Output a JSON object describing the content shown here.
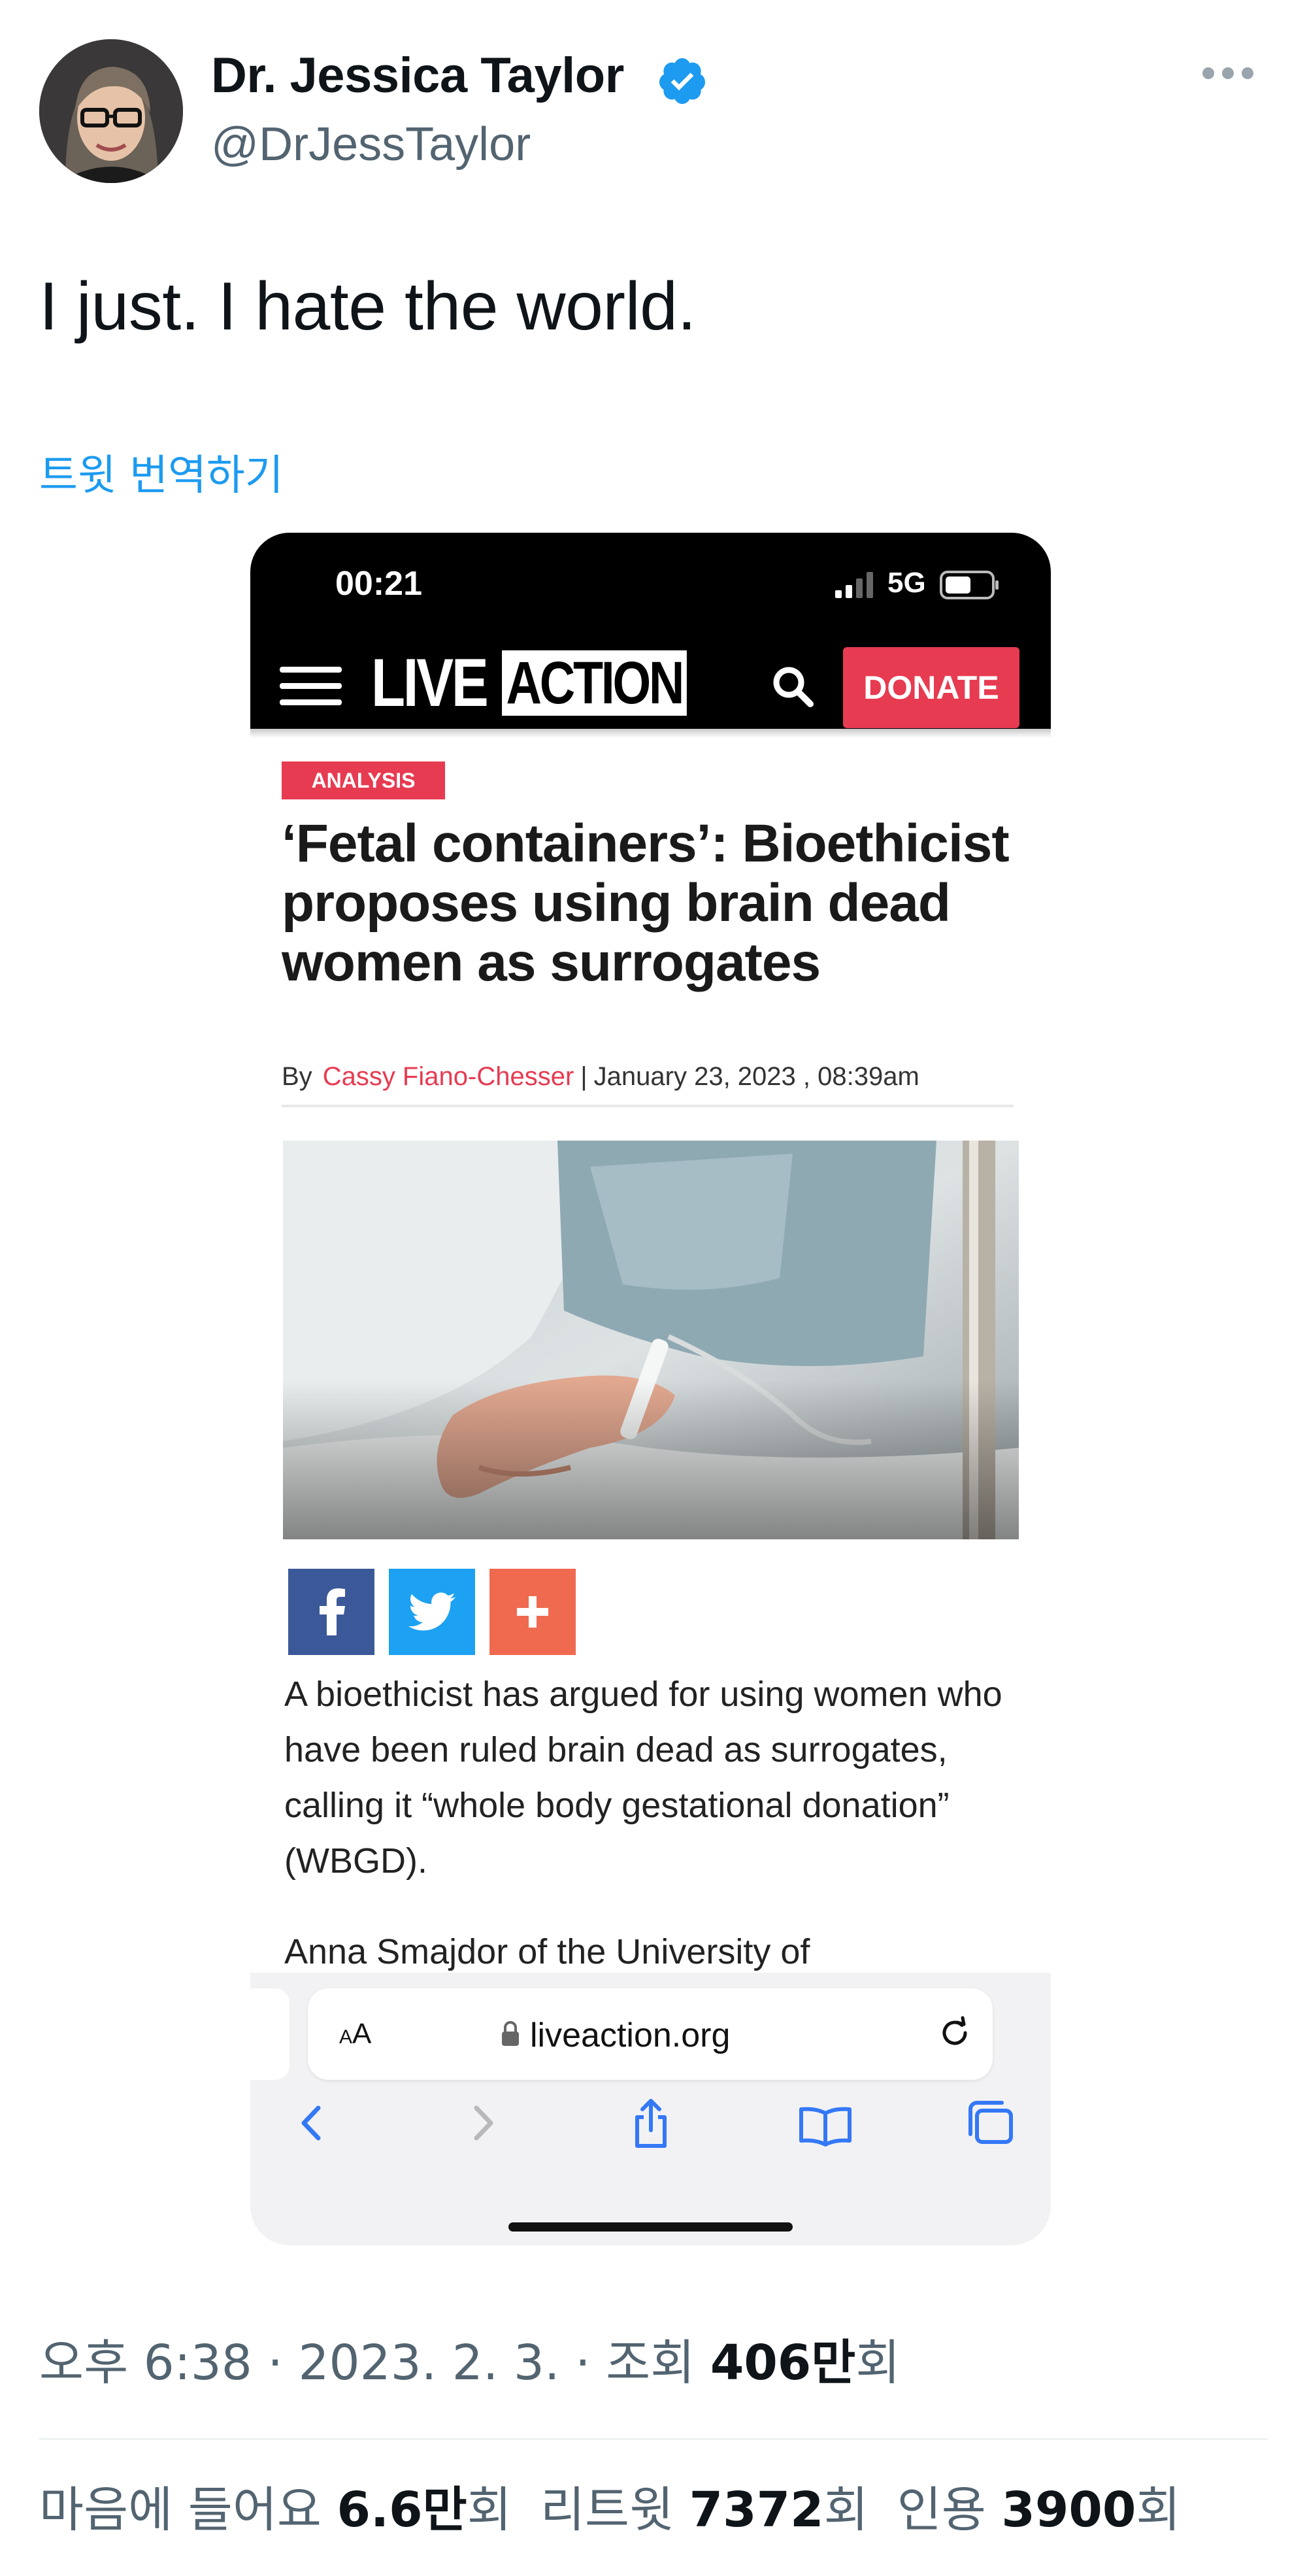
{
  "tweet": {
    "author": {
      "display_name": "Dr. Jessica Taylor",
      "handle": "@DrJessTaylor",
      "verified": true
    },
    "text": "I just. I hate the world.",
    "translate_label": "트윗 번역하기",
    "meta": {
      "time": "오후 6:38",
      "date": "2023. 2. 3.",
      "views_label": "조회",
      "views_value": "406만",
      "views_suffix": "회"
    },
    "stats": {
      "likes_label": "마음에 들어요",
      "likes_value": "6.6만",
      "likes_suffix": "회",
      "retweets_label": "리트윗",
      "retweets_value": "7372",
      "retweets_suffix": "회",
      "quotes_label": "인용",
      "quotes_value": "3900",
      "quotes_suffix": "회"
    }
  },
  "screenshot": {
    "status": {
      "time": "00:21",
      "network": "5G"
    },
    "site": {
      "logo_part1": "LIVE",
      "logo_part2": "ACTION",
      "donate_label": "DONATE"
    },
    "article": {
      "badge": "ANALYSIS",
      "headline": "‘Fetal containers’: Bioethicist proposes using brain dead women as surrogates",
      "by_label": "By",
      "author": "Cassy Fiano-Chesser",
      "separator": "|",
      "date": "January 23, 2023 , 08:39am",
      "paragraph1": "A bioethicist has argued for using women who have been ruled brain dead as surrogates, calling it “whole body gestational donation” (WBGD).",
      "paragraph2_start": "Anna Smajdor of the University of"
    },
    "browser": {
      "aa_small": "A",
      "aa_large": "A",
      "url": "liveaction.org"
    }
  },
  "colors": {
    "link_blue": "#1d9bf0",
    "liveaction_red": "#e73b51",
    "facebook": "#3b5998",
    "twitter": "#1da1f2",
    "share_plus": "#f06a50"
  },
  "icons": [
    "verified-badge-icon",
    "more-icon",
    "signal-icon",
    "battery-icon",
    "hamburger-menu-icon",
    "search-icon",
    "facebook-icon",
    "twitter-icon",
    "plus-icon",
    "lock-icon",
    "reload-icon",
    "back-icon",
    "forward-icon",
    "share-icon",
    "bookmarks-icon",
    "tabs-icon"
  ]
}
